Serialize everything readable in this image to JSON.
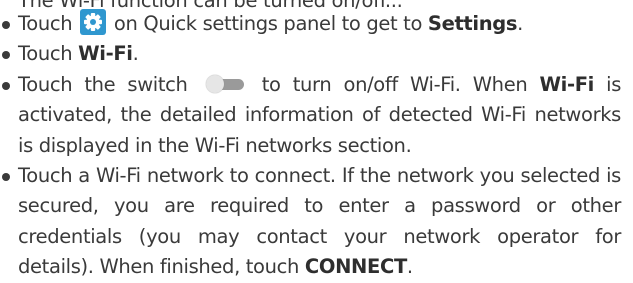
{
  "cut_line": "The Wi-Fi function can be turned on/off...",
  "steps": [
    {
      "before": "Touch ",
      "icon": "settings-gear-icon",
      "after": " on Quick settings panel to get to ",
      "bold": "Settings",
      "end": "."
    },
    {
      "before": "Touch ",
      "bold": "Wi-Fi",
      "end": "."
    },
    {
      "before": "Touch the switch ",
      "icon": "toggle-switch-icon",
      "after": " to turn on/off Wi-Fi. When ",
      "bold": "Wi-Fi",
      "end": " is activated, the detailed information of detected Wi-Fi networks is displayed in the Wi-Fi networks section."
    },
    {
      "before": "Touch a Wi-Fi network to connect. If the network you selected is secured, you are required to enter a password or other credentials (you may contact your network operator for details). When finished, touch ",
      "bold": "CONNECT",
      "end": "."
    }
  ],
  "colors": {
    "text": "#3a3a3a",
    "settings_icon_bg": "#2f97cf",
    "switch_track": "#9a9a9a",
    "switch_knob": "#e6e6e6"
  }
}
